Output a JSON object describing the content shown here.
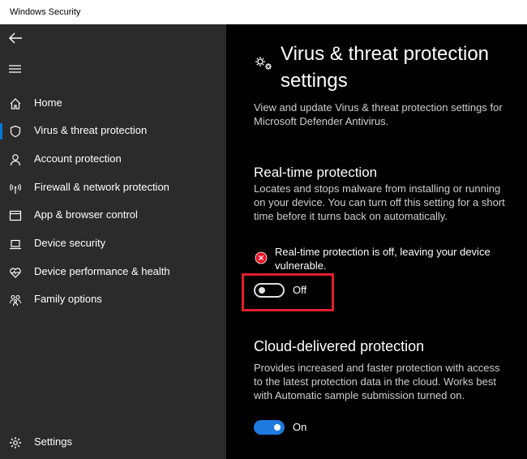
{
  "window": {
    "title": "Windows Security"
  },
  "sidebar": {
    "items": [
      {
        "label": "Home",
        "icon": "home-icon"
      },
      {
        "label": "Virus & threat protection",
        "icon": "shield-icon",
        "active": true
      },
      {
        "label": "Account protection",
        "icon": "person-icon"
      },
      {
        "label": "Firewall & network protection",
        "icon": "wireless-icon"
      },
      {
        "label": "App & browser control",
        "icon": "app-window-icon"
      },
      {
        "label": "Device security",
        "icon": "laptop-icon"
      },
      {
        "label": "Device performance & health",
        "icon": "heart-icon"
      },
      {
        "label": "Family options",
        "icon": "family-icon"
      }
    ],
    "settings_label": "Settings"
  },
  "main": {
    "title": "Virus & threat protection settings",
    "description": "View and update Virus & threat protection settings for Microsoft Defender Antivirus.",
    "realtime": {
      "heading": "Real-time protection",
      "description": "Locates and stops malware from installing or running on your device. You can turn off this setting for a short time before it turns back on automatically.",
      "warning": "Real-time protection is off, leaving your device vulnerable.",
      "toggle_label": "Off",
      "enabled": false
    },
    "cloud": {
      "heading": "Cloud-delivered protection",
      "description": "Provides increased and faster protection with access to the latest protection data in the cloud. Works best with Automatic sample submission turned on.",
      "toggle_label": "On",
      "enabled": true
    }
  },
  "colors": {
    "accent": "#0078d4",
    "toggle_on": "#1f7ae0",
    "warning": "#e81123",
    "highlight": "#e0202b",
    "sidebar_bg": "#2b2b2b"
  }
}
